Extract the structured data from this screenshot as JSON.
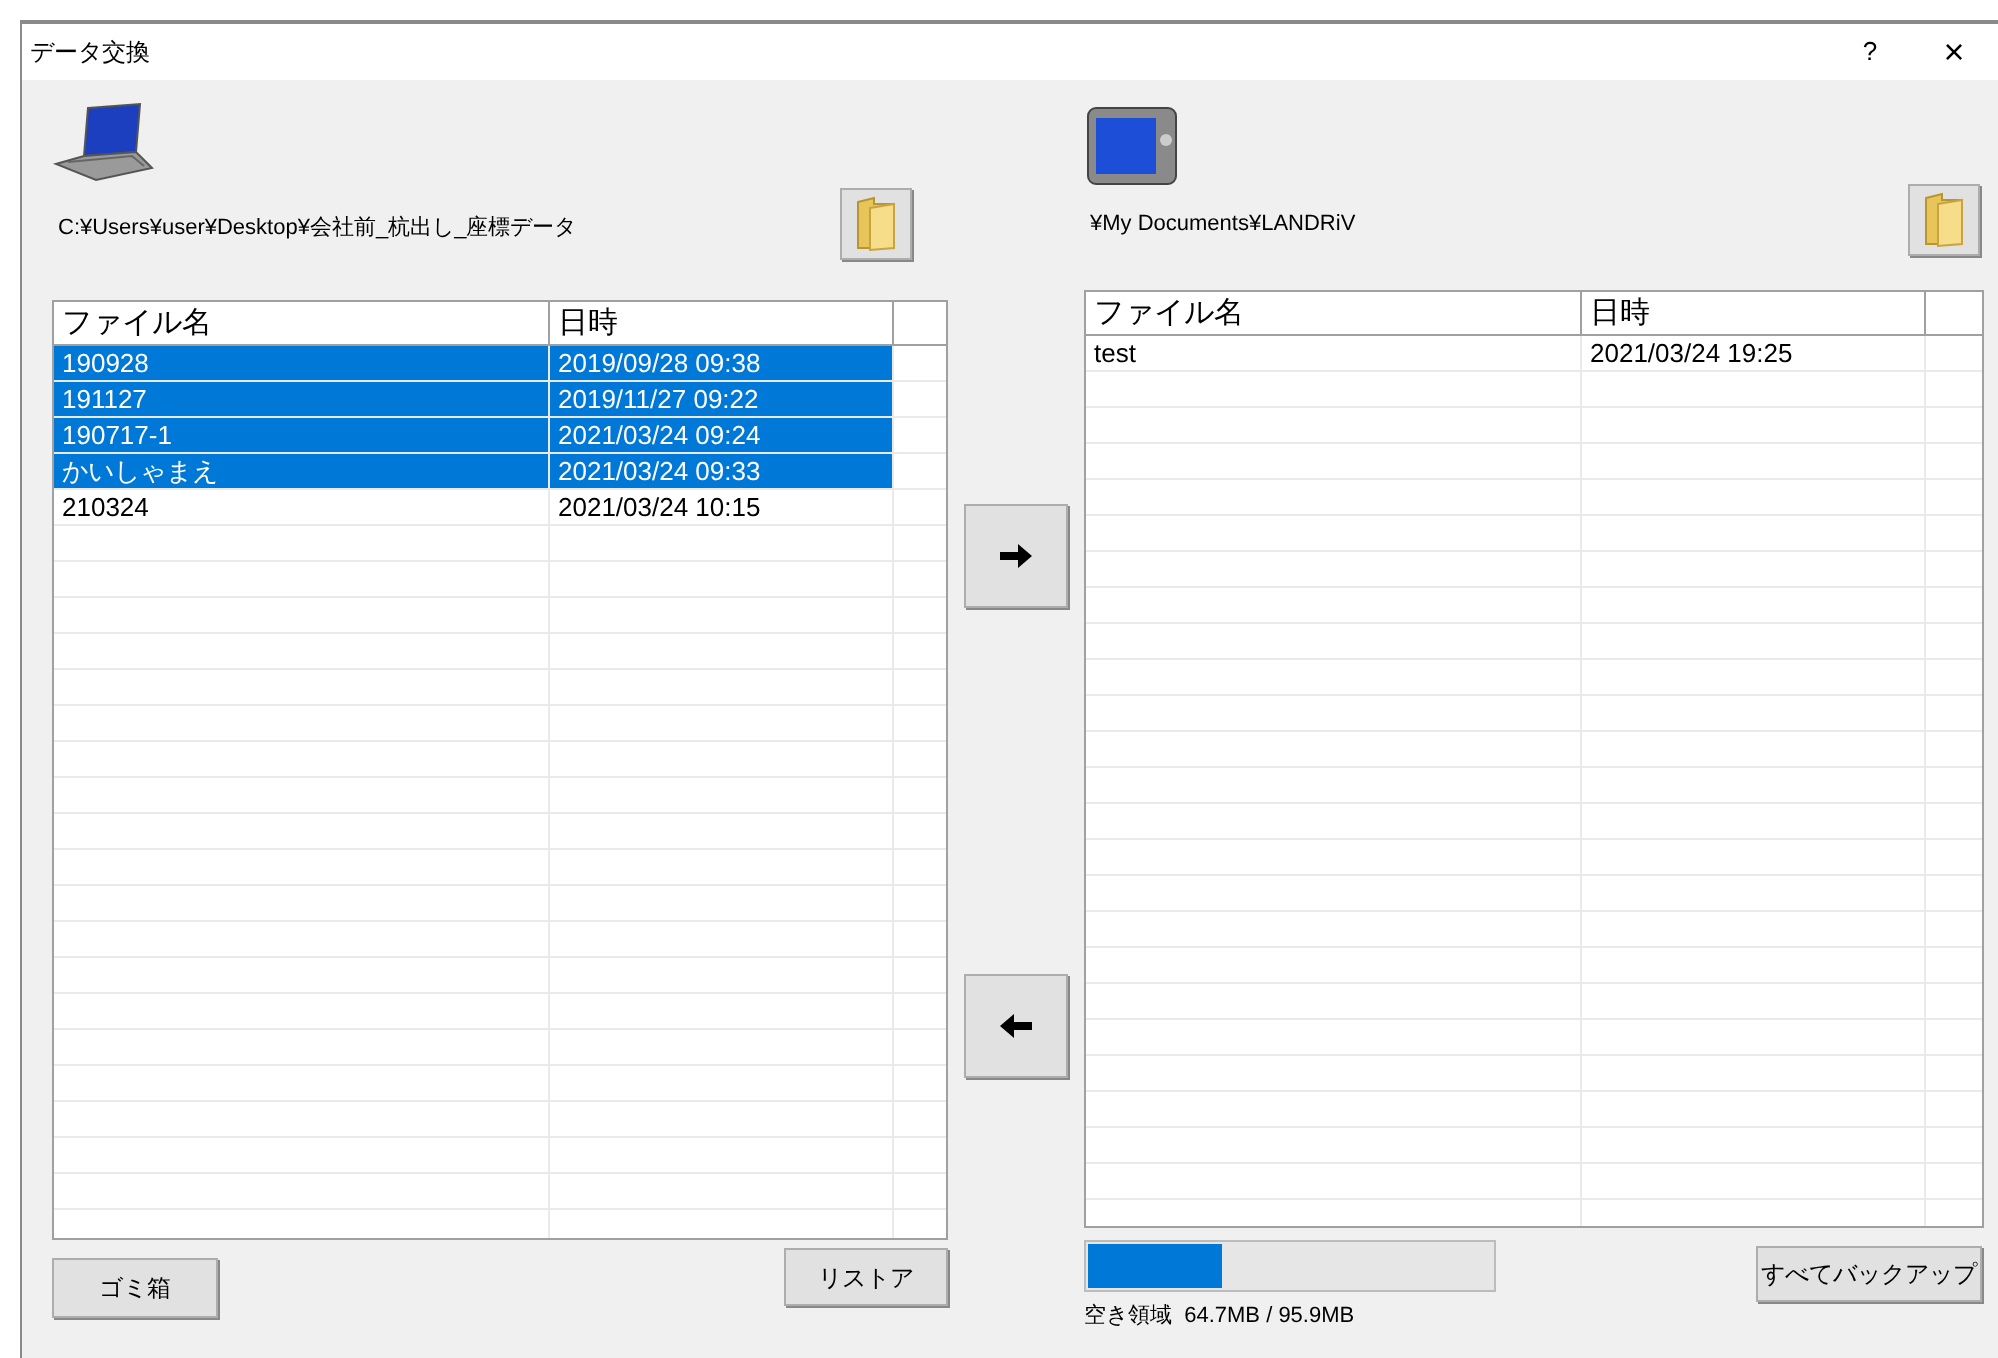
{
  "window": {
    "title": "データ交換",
    "help": "?",
    "close": "×"
  },
  "local": {
    "path": "C:¥Users¥user¥Desktop¥会社前_杭出し_座標データ",
    "columns": [
      "ファイル名",
      "日時"
    ],
    "rows": [
      {
        "name": "190928",
        "date": "2019/09/28 09:38",
        "selected": true
      },
      {
        "name": "191127",
        "date": "2019/11/27 09:22",
        "selected": true
      },
      {
        "name": "190717-1",
        "date": "2021/03/24 09:24",
        "selected": true
      },
      {
        "name": "かいしゃまえ",
        "date": "2021/03/24 09:33",
        "selected": true
      },
      {
        "name": "210324",
        "date": "2021/03/24 10:15",
        "selected": false
      }
    ],
    "buttons": [
      "ゴミ箱",
      "リストア"
    ]
  },
  "device": {
    "path": "¥My Documents¥LANDRiV",
    "columns": [
      "ファイル名",
      "日時"
    ],
    "rows": [
      {
        "name": "test",
        "date": "2021/03/24 19:25",
        "selected": false
      }
    ],
    "storage": {
      "level": 0.33,
      "reading": "空き領域  64.7MB / 95.9MB"
    },
    "backup_button": "すべてバックアップ"
  }
}
